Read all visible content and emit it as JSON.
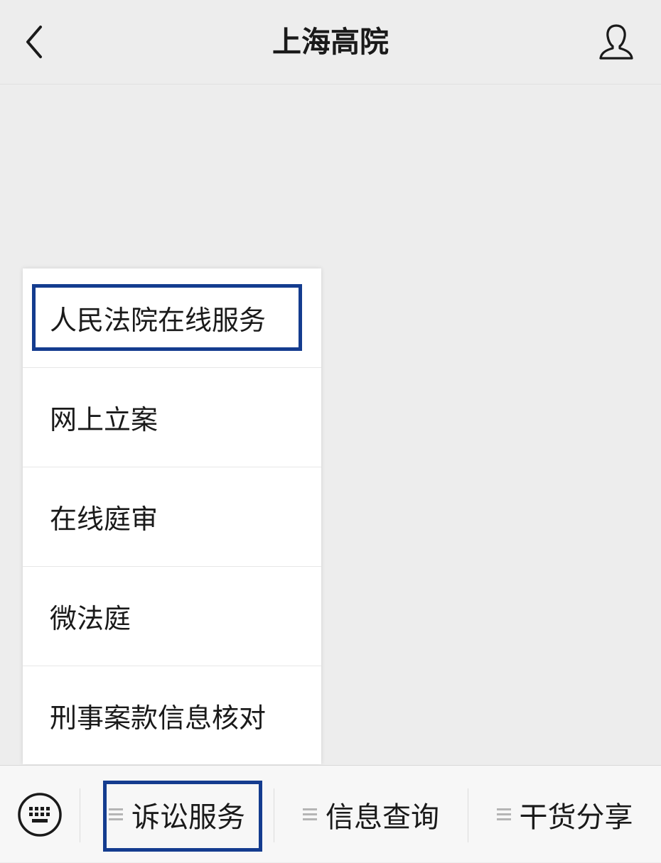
{
  "header": {
    "title": "上海高院",
    "back_icon": "chevron-left-icon",
    "profile_icon": "user-icon"
  },
  "popup_menu": {
    "items": [
      {
        "label": "人民法院在线服务",
        "highlighted": true
      },
      {
        "label": "网上立案"
      },
      {
        "label": "在线庭审"
      },
      {
        "label": "微法庭"
      },
      {
        "label": "刑事案款信息核对"
      }
    ]
  },
  "bottom_bar": {
    "keyboard_icon": "keyboard-icon",
    "tabs": [
      {
        "label": "诉讼服务",
        "highlighted": true
      },
      {
        "label": "信息查询"
      },
      {
        "label": "干货分享"
      }
    ]
  },
  "colors": {
    "highlight": "#143c8f",
    "background": "#ededed"
  }
}
